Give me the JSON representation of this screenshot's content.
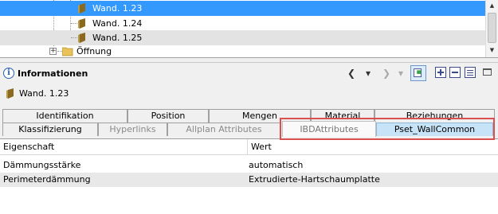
{
  "tree": {
    "items": [
      {
        "label": "Wand. 1.23",
        "selected": true
      },
      {
        "label": "Wand. 1.24",
        "selected": false
      },
      {
        "label": "Wand. 1.25",
        "selected": false
      },
      {
        "label": "Öffnung",
        "selected": false
      }
    ]
  },
  "info": {
    "title": "Informationen",
    "element_name": "Wand. 1.23",
    "toolbar": {
      "back": "❮",
      "dropdown": "▾",
      "forward": "❯",
      "dropdown2": "▾"
    }
  },
  "tabs": {
    "row1": [
      "Identifikation",
      "Position",
      "Mengen",
      "Material",
      "Beziehungen"
    ],
    "row2": [
      "Klassifizierung",
      "Hyperlinks",
      "Allplan Attributes",
      "IBDAttributes",
      "Pset_WallCommon"
    ]
  },
  "table": {
    "headers": [
      "Eigenschaft",
      "Wert"
    ],
    "rows": [
      [
        "Dämmungsstärke",
        "automatisch"
      ],
      [
        "Perimeterdämmung",
        "Extrudierte-Hartschaumplatte"
      ]
    ]
  },
  "colors": {
    "selection": "#3399ff",
    "active_tab": "#c7e3f7",
    "highlight": "#d9504f"
  }
}
